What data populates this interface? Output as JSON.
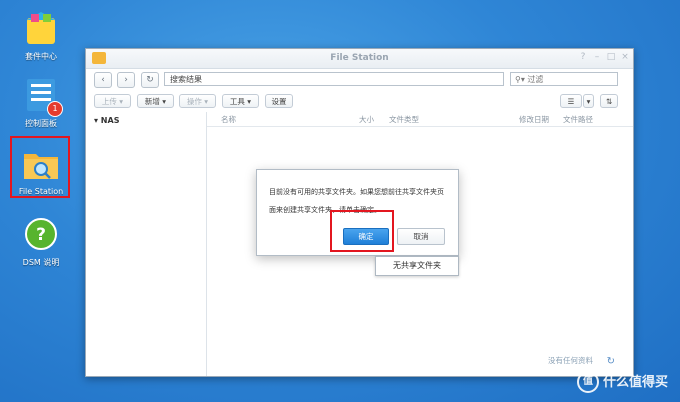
{
  "desktop": {
    "icons": [
      {
        "label": "套件中心"
      },
      {
        "label": "控制面板",
        "badge": "1"
      },
      {
        "label": "File Station"
      },
      {
        "label": "DSM 说明"
      }
    ]
  },
  "window": {
    "title": "File Station",
    "controls": [
      "?",
      "–",
      "□",
      "×"
    ],
    "path": "搜索结果",
    "filter_placeholder": "过滤",
    "toolbar": {
      "upload": "上传 ▾",
      "new": "新增 ▾",
      "action": "操作 ▾",
      "tools": "工具 ▾",
      "settings": "设置"
    },
    "tree_root": "▾ NAS",
    "columns": [
      "名称",
      "大小",
      "文件类型",
      "修改日期",
      "文件路径"
    ],
    "status": "没有任何资料"
  },
  "dialog": {
    "line1": "目前没有可用的共享文件夹。如果您想前往共享文件夹页",
    "line2": "面来创建共享文件夹，请单击确定。",
    "ok": "确定",
    "cancel": "取消"
  },
  "tooltip": "无共享文件夹",
  "watermark": "什么值得买",
  "watermark_glyph": "值",
  "colors": {
    "accent": "#2f86d6",
    "highlight": "#e3161f",
    "ok_button": "#1f7fd8"
  }
}
